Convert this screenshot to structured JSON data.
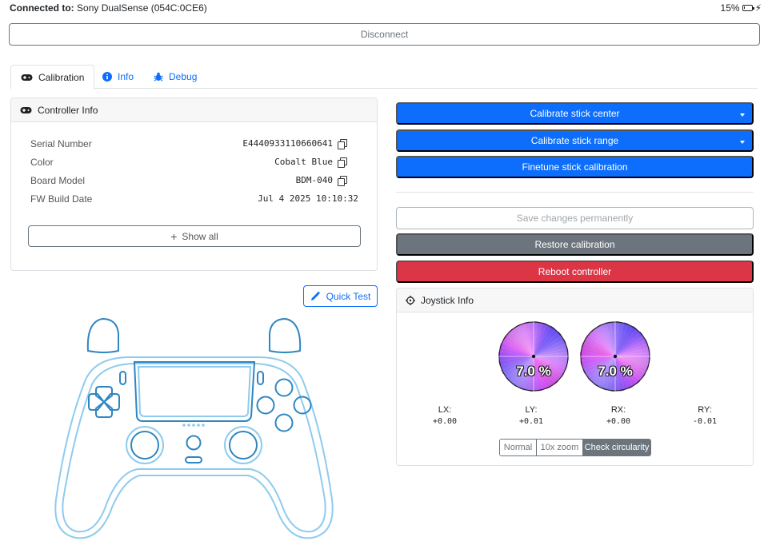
{
  "status": {
    "connected_label": "Connected to:",
    "device": "Sony DualSense (054C:0CE6)",
    "battery": "15%",
    "battery_level": 0.15
  },
  "disconnect_label": "Disconnect",
  "tabs": [
    {
      "label": "Calibration",
      "active": true
    },
    {
      "label": "Info",
      "active": false
    },
    {
      "label": "Debug",
      "active": false
    }
  ],
  "controller_info": {
    "title": "Controller Info",
    "rows": [
      {
        "label": "Serial Number",
        "value": "E4440933110660641"
      },
      {
        "label": "Color",
        "value": "Cobalt Blue"
      },
      {
        "label": "Board Model",
        "value": "BDM-040"
      },
      {
        "label": "FW Build Date",
        "value": "Jul 4 2025 10:10:32"
      }
    ],
    "show_all_label": "Show all"
  },
  "quick_test_label": "Quick Test",
  "actions": {
    "calibrate_center": "Calibrate stick center",
    "calibrate_range": "Calibrate stick range",
    "finetune": "Finetune stick calibration",
    "save": "Save changes permanently",
    "restore": "Restore calibration",
    "reboot": "Reboot controller"
  },
  "joystick_info": {
    "title": "Joystick Info",
    "left_circularity": "7.0 %",
    "right_circularity": "7.0 %",
    "axes": [
      {
        "label": "LX:",
        "value": "+0.00"
      },
      {
        "label": "LY:",
        "value": "+0.01"
      },
      {
        "label": "RX:",
        "value": "+0.00"
      },
      {
        "label": "RY:",
        "value": "-0.01"
      }
    ],
    "modes": [
      {
        "label": "Normal",
        "active": false
      },
      {
        "label": "10x zoom",
        "active": false
      },
      {
        "label": "Check circularity",
        "active": true
      }
    ]
  },
  "colors": {
    "primary": "#0d6efd",
    "secondary": "#6c757d",
    "danger": "#dc3545",
    "controller_outline": "#8ecbee",
    "controller_accent": "#2e86c1"
  }
}
